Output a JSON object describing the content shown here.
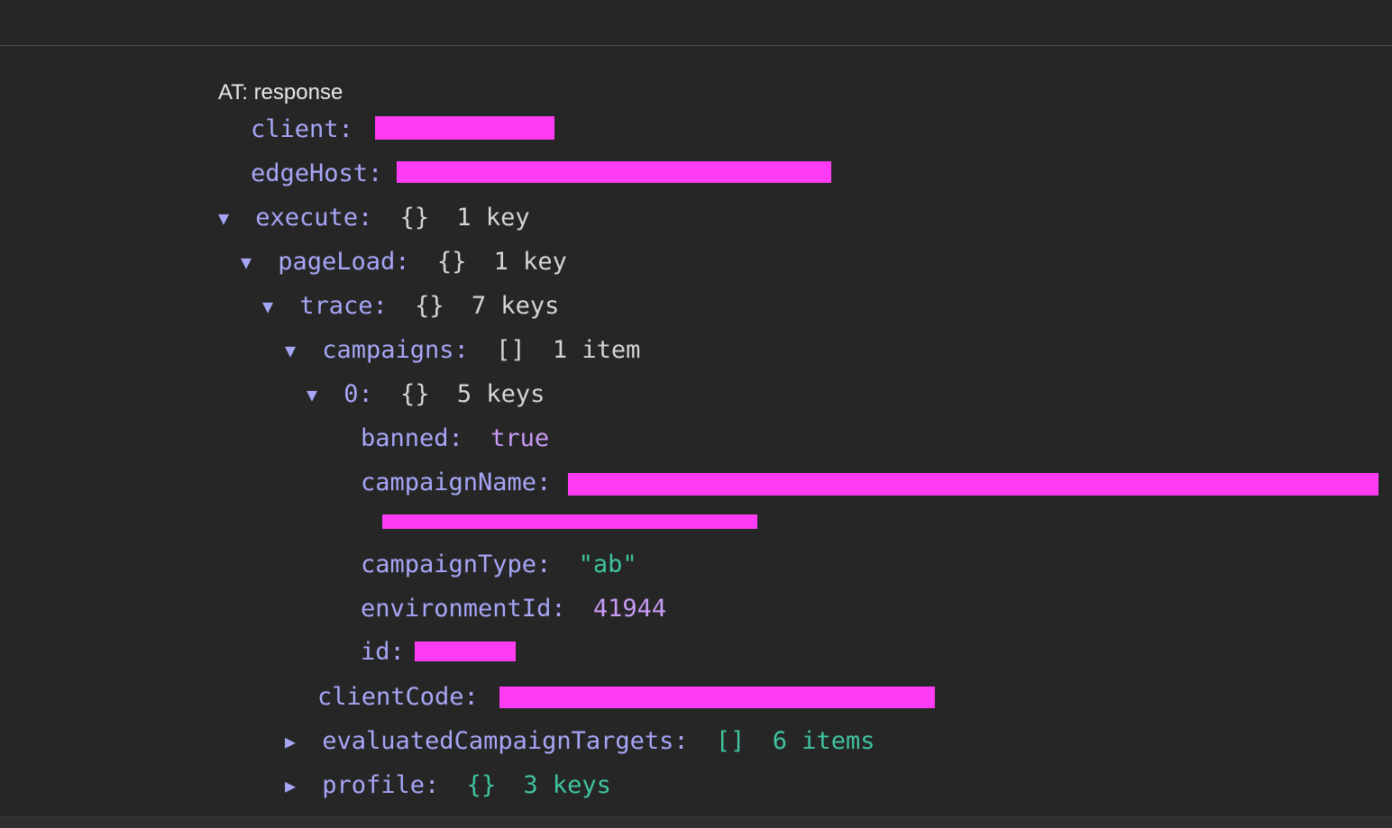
{
  "header": {
    "label": "AT: response"
  },
  "icons": {
    "expanded": "▼",
    "collapsed": "▶"
  },
  "tree": {
    "client_key": "client:",
    "edge_host_key": "edgeHost:",
    "execute": {
      "key": "execute:",
      "braces": "{}",
      "count": "1 key"
    },
    "page_load": {
      "key": "pageLoad:",
      "braces": "{}",
      "count": "1 key"
    },
    "trace": {
      "key": "trace:",
      "braces": "{}",
      "count": "7 keys"
    },
    "campaigns": {
      "key": "campaigns:",
      "braces": "[]",
      "count": "1 item"
    },
    "item0": {
      "key": "0:",
      "braces": "{}",
      "count": "5 keys"
    },
    "banned": {
      "key": "banned:",
      "value": "true"
    },
    "campaign_name_key": "campaignName:",
    "campaign_type": {
      "key": "campaignType:",
      "value": "\"ab\""
    },
    "environment_id": {
      "key": "environmentId:",
      "value": "41944"
    },
    "id_key": "id:",
    "client_code_key": "clientCode:",
    "evaluated": {
      "key": "evaluatedCampaignTargets:",
      "braces": "[]",
      "count": "6 items"
    },
    "profile": {
      "key": "profile:",
      "braces": "{}",
      "count": "3 keys"
    }
  },
  "colors": {
    "background": "#262626",
    "key": "#a6a6f7",
    "string": "#3fc4a0",
    "number": "#c89bf5",
    "redaction": "#ff3cf4"
  }
}
